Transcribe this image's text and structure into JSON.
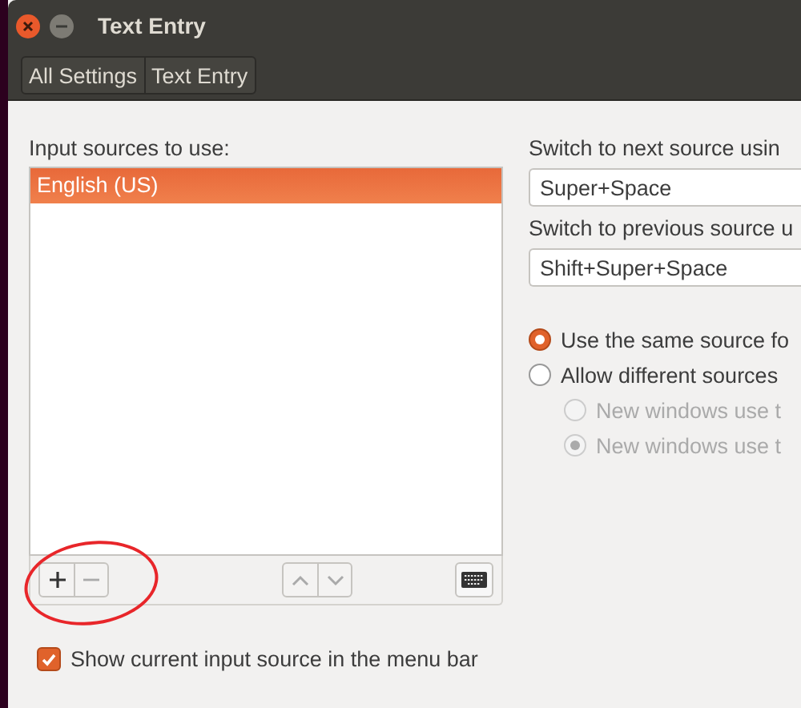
{
  "window": {
    "title": "Text Entry"
  },
  "breadcrumbs": [
    {
      "label": "All Settings"
    },
    {
      "label": "Text Entry"
    }
  ],
  "input_sources": {
    "label": "Input sources to use:",
    "items": [
      {
        "label": "English (US)",
        "selected": true
      }
    ]
  },
  "show_indicator": {
    "label": "Show current input source in the menu bar",
    "checked": true
  },
  "shortcuts": [
    {
      "label": "Switch to next source usin",
      "value": "Super+Space"
    },
    {
      "label": "Switch to previous source u",
      "value": "Shift+Super+Space"
    }
  ],
  "source_mode": [
    {
      "label": "Use the same source fo",
      "selected": true,
      "disabled": false
    },
    {
      "label": "Allow different sources",
      "selected": false,
      "disabled": false,
      "children": [
        {
          "label": "New windows use t",
          "selected": false,
          "disabled": true
        },
        {
          "label": "New windows use t",
          "selected": true,
          "disabled": true
        }
      ]
    }
  ]
}
